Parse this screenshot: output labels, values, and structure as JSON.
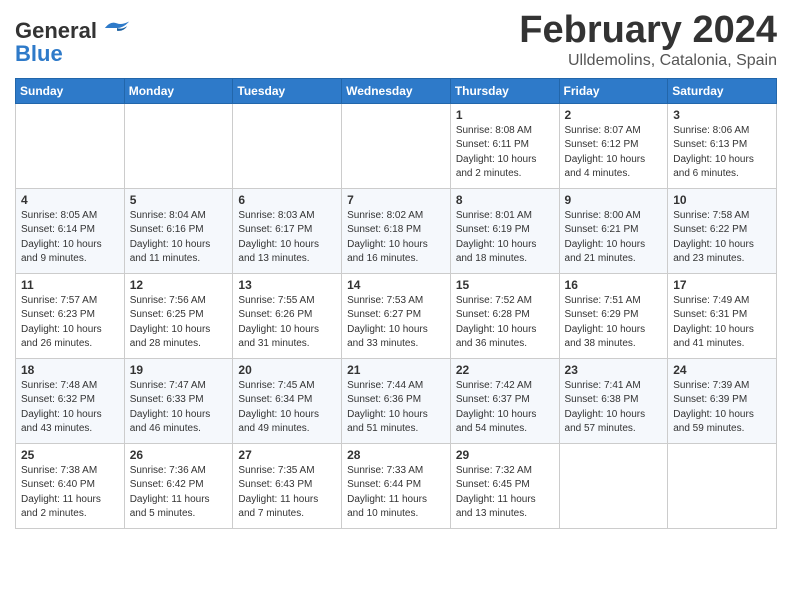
{
  "logo": {
    "general": "General",
    "blue": "Blue"
  },
  "title": "February 2024",
  "subtitle": "Ulldemolins, Catalonia, Spain",
  "headers": [
    "Sunday",
    "Monday",
    "Tuesday",
    "Wednesday",
    "Thursday",
    "Friday",
    "Saturday"
  ],
  "weeks": [
    [
      {
        "day": "",
        "info": ""
      },
      {
        "day": "",
        "info": ""
      },
      {
        "day": "",
        "info": ""
      },
      {
        "day": "",
        "info": ""
      },
      {
        "day": "1",
        "info": "Sunrise: 8:08 AM\nSunset: 6:11 PM\nDaylight: 10 hours\nand 2 minutes."
      },
      {
        "day": "2",
        "info": "Sunrise: 8:07 AM\nSunset: 6:12 PM\nDaylight: 10 hours\nand 4 minutes."
      },
      {
        "day": "3",
        "info": "Sunrise: 8:06 AM\nSunset: 6:13 PM\nDaylight: 10 hours\nand 6 minutes."
      }
    ],
    [
      {
        "day": "4",
        "info": "Sunrise: 8:05 AM\nSunset: 6:14 PM\nDaylight: 10 hours\nand 9 minutes."
      },
      {
        "day": "5",
        "info": "Sunrise: 8:04 AM\nSunset: 6:16 PM\nDaylight: 10 hours\nand 11 minutes."
      },
      {
        "day": "6",
        "info": "Sunrise: 8:03 AM\nSunset: 6:17 PM\nDaylight: 10 hours\nand 13 minutes."
      },
      {
        "day": "7",
        "info": "Sunrise: 8:02 AM\nSunset: 6:18 PM\nDaylight: 10 hours\nand 16 minutes."
      },
      {
        "day": "8",
        "info": "Sunrise: 8:01 AM\nSunset: 6:19 PM\nDaylight: 10 hours\nand 18 minutes."
      },
      {
        "day": "9",
        "info": "Sunrise: 8:00 AM\nSunset: 6:21 PM\nDaylight: 10 hours\nand 21 minutes."
      },
      {
        "day": "10",
        "info": "Sunrise: 7:58 AM\nSunset: 6:22 PM\nDaylight: 10 hours\nand 23 minutes."
      }
    ],
    [
      {
        "day": "11",
        "info": "Sunrise: 7:57 AM\nSunset: 6:23 PM\nDaylight: 10 hours\nand 26 minutes."
      },
      {
        "day": "12",
        "info": "Sunrise: 7:56 AM\nSunset: 6:25 PM\nDaylight: 10 hours\nand 28 minutes."
      },
      {
        "day": "13",
        "info": "Sunrise: 7:55 AM\nSunset: 6:26 PM\nDaylight: 10 hours\nand 31 minutes."
      },
      {
        "day": "14",
        "info": "Sunrise: 7:53 AM\nSunset: 6:27 PM\nDaylight: 10 hours\nand 33 minutes."
      },
      {
        "day": "15",
        "info": "Sunrise: 7:52 AM\nSunset: 6:28 PM\nDaylight: 10 hours\nand 36 minutes."
      },
      {
        "day": "16",
        "info": "Sunrise: 7:51 AM\nSunset: 6:29 PM\nDaylight: 10 hours\nand 38 minutes."
      },
      {
        "day": "17",
        "info": "Sunrise: 7:49 AM\nSunset: 6:31 PM\nDaylight: 10 hours\nand 41 minutes."
      }
    ],
    [
      {
        "day": "18",
        "info": "Sunrise: 7:48 AM\nSunset: 6:32 PM\nDaylight: 10 hours\nand 43 minutes."
      },
      {
        "day": "19",
        "info": "Sunrise: 7:47 AM\nSunset: 6:33 PM\nDaylight: 10 hours\nand 46 minutes."
      },
      {
        "day": "20",
        "info": "Sunrise: 7:45 AM\nSunset: 6:34 PM\nDaylight: 10 hours\nand 49 minutes."
      },
      {
        "day": "21",
        "info": "Sunrise: 7:44 AM\nSunset: 6:36 PM\nDaylight: 10 hours\nand 51 minutes."
      },
      {
        "day": "22",
        "info": "Sunrise: 7:42 AM\nSunset: 6:37 PM\nDaylight: 10 hours\nand 54 minutes."
      },
      {
        "day": "23",
        "info": "Sunrise: 7:41 AM\nSunset: 6:38 PM\nDaylight: 10 hours\nand 57 minutes."
      },
      {
        "day": "24",
        "info": "Sunrise: 7:39 AM\nSunset: 6:39 PM\nDaylight: 10 hours\nand 59 minutes."
      }
    ],
    [
      {
        "day": "25",
        "info": "Sunrise: 7:38 AM\nSunset: 6:40 PM\nDaylight: 11 hours\nand 2 minutes."
      },
      {
        "day": "26",
        "info": "Sunrise: 7:36 AM\nSunset: 6:42 PM\nDaylight: 11 hours\nand 5 minutes."
      },
      {
        "day": "27",
        "info": "Sunrise: 7:35 AM\nSunset: 6:43 PM\nDaylight: 11 hours\nand 7 minutes."
      },
      {
        "day": "28",
        "info": "Sunrise: 7:33 AM\nSunset: 6:44 PM\nDaylight: 11 hours\nand 10 minutes."
      },
      {
        "day": "29",
        "info": "Sunrise: 7:32 AM\nSunset: 6:45 PM\nDaylight: 11 hours\nand 13 minutes."
      },
      {
        "day": "",
        "info": ""
      },
      {
        "day": "",
        "info": ""
      }
    ]
  ]
}
